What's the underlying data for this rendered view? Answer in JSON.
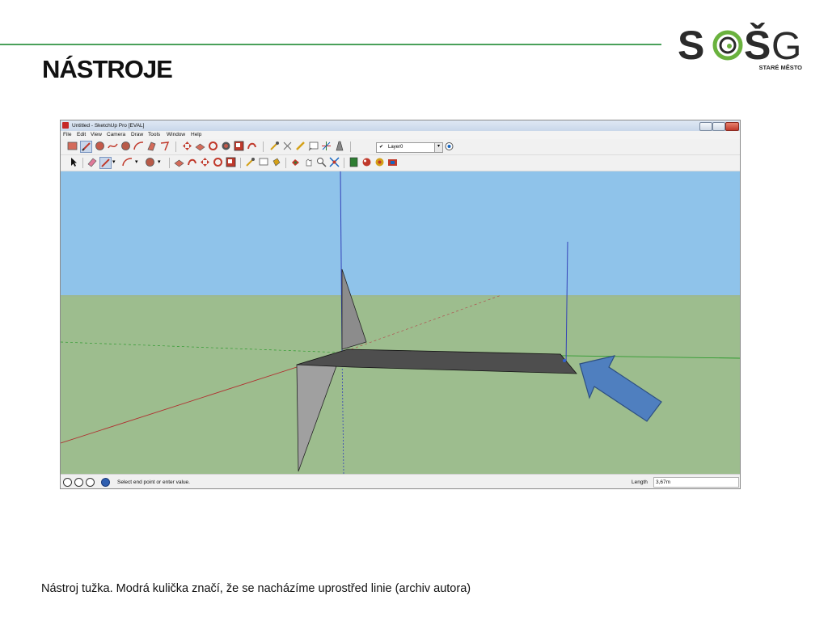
{
  "slide": {
    "title": "NÁSTROJE",
    "caption": "Nástroj tužka. Modrá kulička značí, že se nacházíme uprostřed linie (archiv autora)"
  },
  "logo": {
    "letters": [
      "S",
      "Š",
      "G"
    ],
    "subtitle": "STARÉ MĚSTO",
    "colors": {
      "dark": "#2b2b2b",
      "green": "#6ab23e"
    }
  },
  "app": {
    "window_title": "Untitled - SketchUp Pro [EVAL]",
    "menu": [
      "File",
      "Edit",
      "View",
      "Camera",
      "Draw",
      "Tools",
      "Window",
      "Help"
    ],
    "layer": {
      "check": "✔",
      "name": "Layer0"
    },
    "status_hint": "Select end point or enter value.",
    "measurement": {
      "label": "Length",
      "value": "3,67m"
    },
    "colors": {
      "sky": "#8fc3ea",
      "ground": "#9dbd8e",
      "arrow": "#4f7fbf"
    },
    "active_tool": "pencil-icon"
  }
}
